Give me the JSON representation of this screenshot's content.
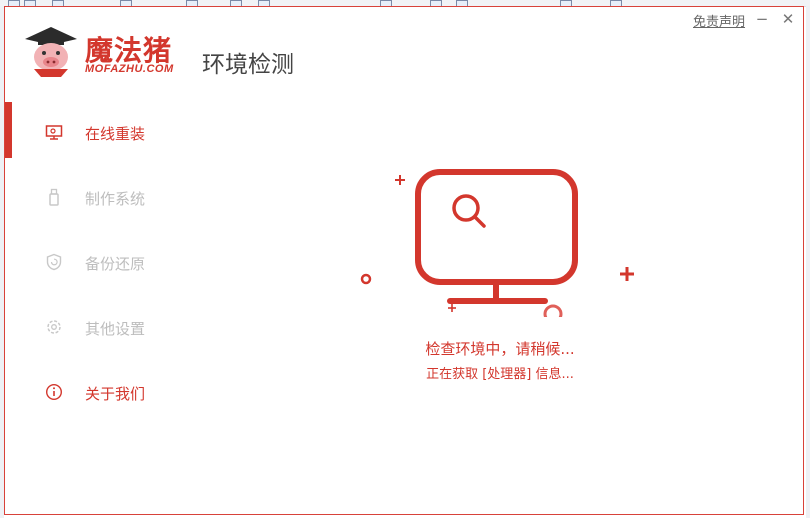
{
  "app": {
    "logo_name": "魔法猪",
    "logo_domain": "MOFAZHU.COM",
    "page_title": "环境检测",
    "disclaimer": "免责声明",
    "minimize_glyph": "−",
    "close_glyph": "✕"
  },
  "sidebar": {
    "items": [
      {
        "label": "在线重装",
        "icon": "monitor-icon",
        "state": "active"
      },
      {
        "label": "制作系统",
        "icon": "usb-drive-icon",
        "state": "disabled"
      },
      {
        "label": "备份还原",
        "icon": "shield-restore-icon",
        "state": "disabled"
      },
      {
        "label": "其他设置",
        "icon": "gear-icon",
        "state": "disabled"
      },
      {
        "label": "关于我们",
        "icon": "info-icon",
        "state": "normal"
      }
    ]
  },
  "status": {
    "main": "检查环境中，请稍候...",
    "sub": "正在获取 [处理器] 信息..."
  },
  "colors": {
    "accent": "#d3372d",
    "disabled": "#bdbdbd",
    "title": "#444444"
  }
}
